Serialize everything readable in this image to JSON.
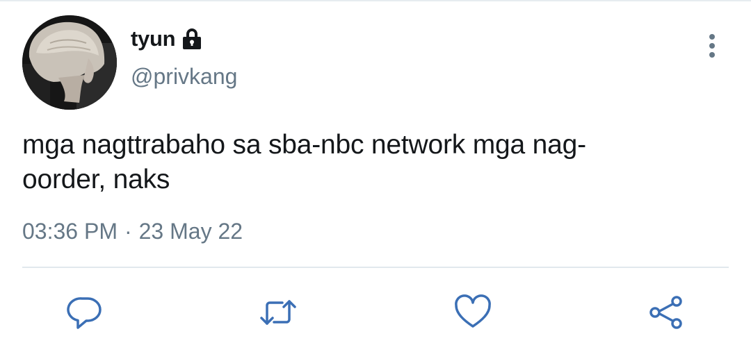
{
  "user": {
    "display_name": "tyun",
    "handle": "@privkang",
    "protected_icon": "lock-icon",
    "avatar_icon": "avatar-photo"
  },
  "tweet": {
    "text": "mga nagttrabaho sa sba-nbc network mga nag-\noorder, naks",
    "time": "03:36 PM",
    "separator": "·",
    "date": "23 May 22"
  },
  "actions": {
    "more": "more-vertical-icon",
    "reply": "reply-icon",
    "retweet": "retweet-icon",
    "like": "heart-icon",
    "share": "share-icon"
  },
  "colors": {
    "text": "#14171a",
    "secondary": "#657786",
    "action_icon": "#3b6fb5",
    "divider": "#e1e8ed"
  }
}
